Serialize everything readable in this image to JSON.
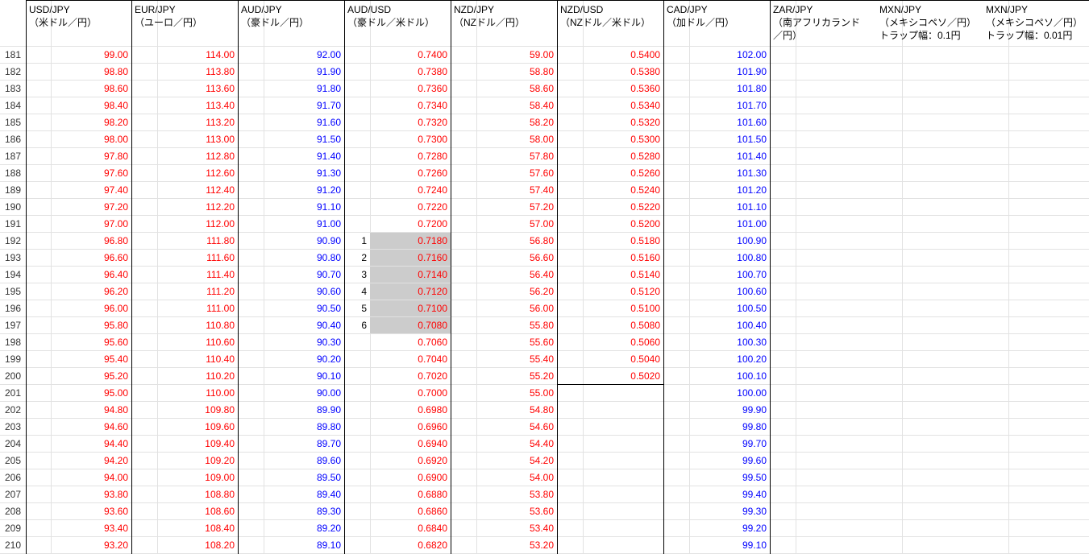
{
  "headers": [
    "USD/JPY\n（米ドル／円）",
    "EUR/JPY\n（ユーロ／円）",
    "AUD/JPY\n（豪ドル／円）",
    "AUD/USD\n（豪ドル／米ドル）",
    "NZD/JPY\n（NZドル／円）",
    "NZD/USD\n（NZドル／米ドル）",
    "CAD/JPY\n（加ドル／円）",
    "ZAR/JPY\n（南アフリカランド\n／円）",
    "MXN/JPY\n（メキシコペソ／円）\nトラップ幅：0.1円",
    "MXN/JPY\n（メキシコペソ／円）\nトラップ幅：0.01円"
  ],
  "row_numbers": [
    "181",
    "182",
    "183",
    "184",
    "185",
    "186",
    "187",
    "188",
    "189",
    "190",
    "191",
    "192",
    "193",
    "194",
    "195",
    "196",
    "197",
    "198",
    "199",
    "200",
    "201",
    "202",
    "203",
    "204",
    "205",
    "206",
    "207",
    "208",
    "209",
    "210"
  ],
  "usd_jpy": [
    "99.00",
    "98.80",
    "98.60",
    "98.40",
    "98.20",
    "98.00",
    "97.80",
    "97.60",
    "97.40",
    "97.20",
    "97.00",
    "96.80",
    "96.60",
    "96.40",
    "96.20",
    "96.00",
    "95.80",
    "95.60",
    "95.40",
    "95.20",
    "95.00",
    "94.80",
    "94.60",
    "94.40",
    "94.20",
    "94.00",
    "93.80",
    "93.60",
    "93.40",
    "93.20"
  ],
  "eur_jpy": [
    "114.00",
    "113.80",
    "113.60",
    "113.40",
    "113.20",
    "113.00",
    "112.80",
    "112.60",
    "112.40",
    "112.20",
    "112.00",
    "111.80",
    "111.60",
    "111.40",
    "111.20",
    "111.00",
    "110.80",
    "110.60",
    "110.40",
    "110.20",
    "110.00",
    "109.80",
    "109.60",
    "109.40",
    "109.20",
    "109.00",
    "108.80",
    "108.60",
    "108.40",
    "108.20"
  ],
  "aud_jpy": [
    "92.00",
    "91.90",
    "91.80",
    "91.70",
    "91.60",
    "91.50",
    "91.40",
    "91.30",
    "91.20",
    "91.10",
    "91.00",
    "90.90",
    "90.80",
    "90.70",
    "90.60",
    "90.50",
    "90.40",
    "90.30",
    "90.20",
    "90.10",
    "90.00",
    "89.90",
    "89.80",
    "89.70",
    "89.60",
    "89.50",
    "89.40",
    "89.30",
    "89.20",
    "89.10"
  ],
  "aud_usd": [
    "0.7400",
    "0.7380",
    "0.7360",
    "0.7340",
    "0.7320",
    "0.7300",
    "0.7280",
    "0.7260",
    "0.7240",
    "0.7220",
    "0.7200",
    "0.7180",
    "0.7160",
    "0.7140",
    "0.7120",
    "0.7100",
    "0.7080",
    "0.7060",
    "0.7040",
    "0.7020",
    "0.7000",
    "0.6980",
    "0.6960",
    "0.6940",
    "0.6920",
    "0.6900",
    "0.6880",
    "0.6860",
    "0.6840",
    "0.6820"
  ],
  "aud_usd_marks": [
    "",
    "",
    "",
    "",
    "",
    "",
    "",
    "",
    "",
    "",
    "",
    "1",
    "2",
    "3",
    "4",
    "5",
    "6",
    "",
    "",
    "",
    "",
    "",
    "",
    "",
    "",
    "",
    "",
    "",
    "",
    ""
  ],
  "nzd_jpy": [
    "59.00",
    "58.80",
    "58.60",
    "58.40",
    "58.20",
    "58.00",
    "57.80",
    "57.60",
    "57.40",
    "57.20",
    "57.00",
    "56.80",
    "56.60",
    "56.40",
    "56.20",
    "56.00",
    "55.80",
    "55.60",
    "55.40",
    "55.20",
    "55.00",
    "54.80",
    "54.60",
    "54.40",
    "54.20",
    "54.00",
    "53.80",
    "53.60",
    "53.40",
    "53.20"
  ],
  "nzd_usd": [
    "0.5400",
    "0.5380",
    "0.5360",
    "0.5340",
    "0.5320",
    "0.5300",
    "0.5280",
    "0.5260",
    "0.5240",
    "0.5220",
    "0.5200",
    "0.5180",
    "0.5160",
    "0.5140",
    "0.5120",
    "0.5100",
    "0.5080",
    "0.5060",
    "0.5040",
    "0.5020",
    "",
    "",
    "",
    "",
    "",
    "",
    "",
    "",
    "",
    ""
  ],
  "cad_jpy": [
    "102.00",
    "101.90",
    "101.80",
    "101.70",
    "101.60",
    "101.50",
    "101.40",
    "101.30",
    "101.20",
    "101.10",
    "101.00",
    "100.90",
    "100.80",
    "100.70",
    "100.60",
    "100.50",
    "100.40",
    "100.30",
    "100.20",
    "100.10",
    "100.00",
    "99.90",
    "99.80",
    "99.70",
    "99.60",
    "99.50",
    "99.40",
    "99.30",
    "99.20",
    "99.10"
  ],
  "colors": {
    "red": "#ff0000",
    "blue": "#0000ff",
    "shade": "#cccccc",
    "grid": "#e2e2e2",
    "border": "#000000"
  }
}
